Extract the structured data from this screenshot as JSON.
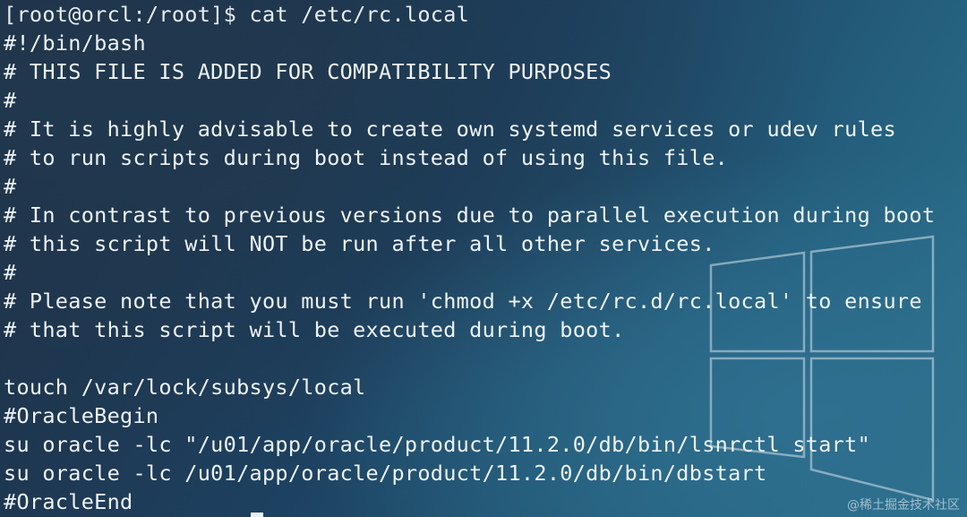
{
  "terminal": {
    "lines": [
      "[root@orcl:/root]$ cat /etc/rc.local",
      "#!/bin/bash",
      "# THIS FILE IS ADDED FOR COMPATIBILITY PURPOSES",
      "#",
      "# It is highly advisable to create own systemd services or udev rules",
      "# to run scripts during boot instead of using this file.",
      "#",
      "# In contrast to previous versions due to parallel execution during boot",
      "# this script will NOT be run after all other services.",
      "#",
      "# Please note that you must run 'chmod +x /etc/rc.d/rc.local' to ensure",
      "# that this script will be executed during boot.",
      "",
      "touch /var/lock/subsys/local",
      "#OracleBegin",
      "su oracle -lc \"/u01/app/oracle/product/11.2.0/db/bin/lsnrctl start\"",
      "su oracle -lc /u01/app/oracle/product/11.2.0/db/bin/dbstart",
      "#OracleEnd"
    ]
  },
  "watermark": "@稀土掘金技术社区",
  "colors": {
    "text": "#eef3f7",
    "background_dark": "#1f2d42",
    "background_light": "#2c7590"
  }
}
